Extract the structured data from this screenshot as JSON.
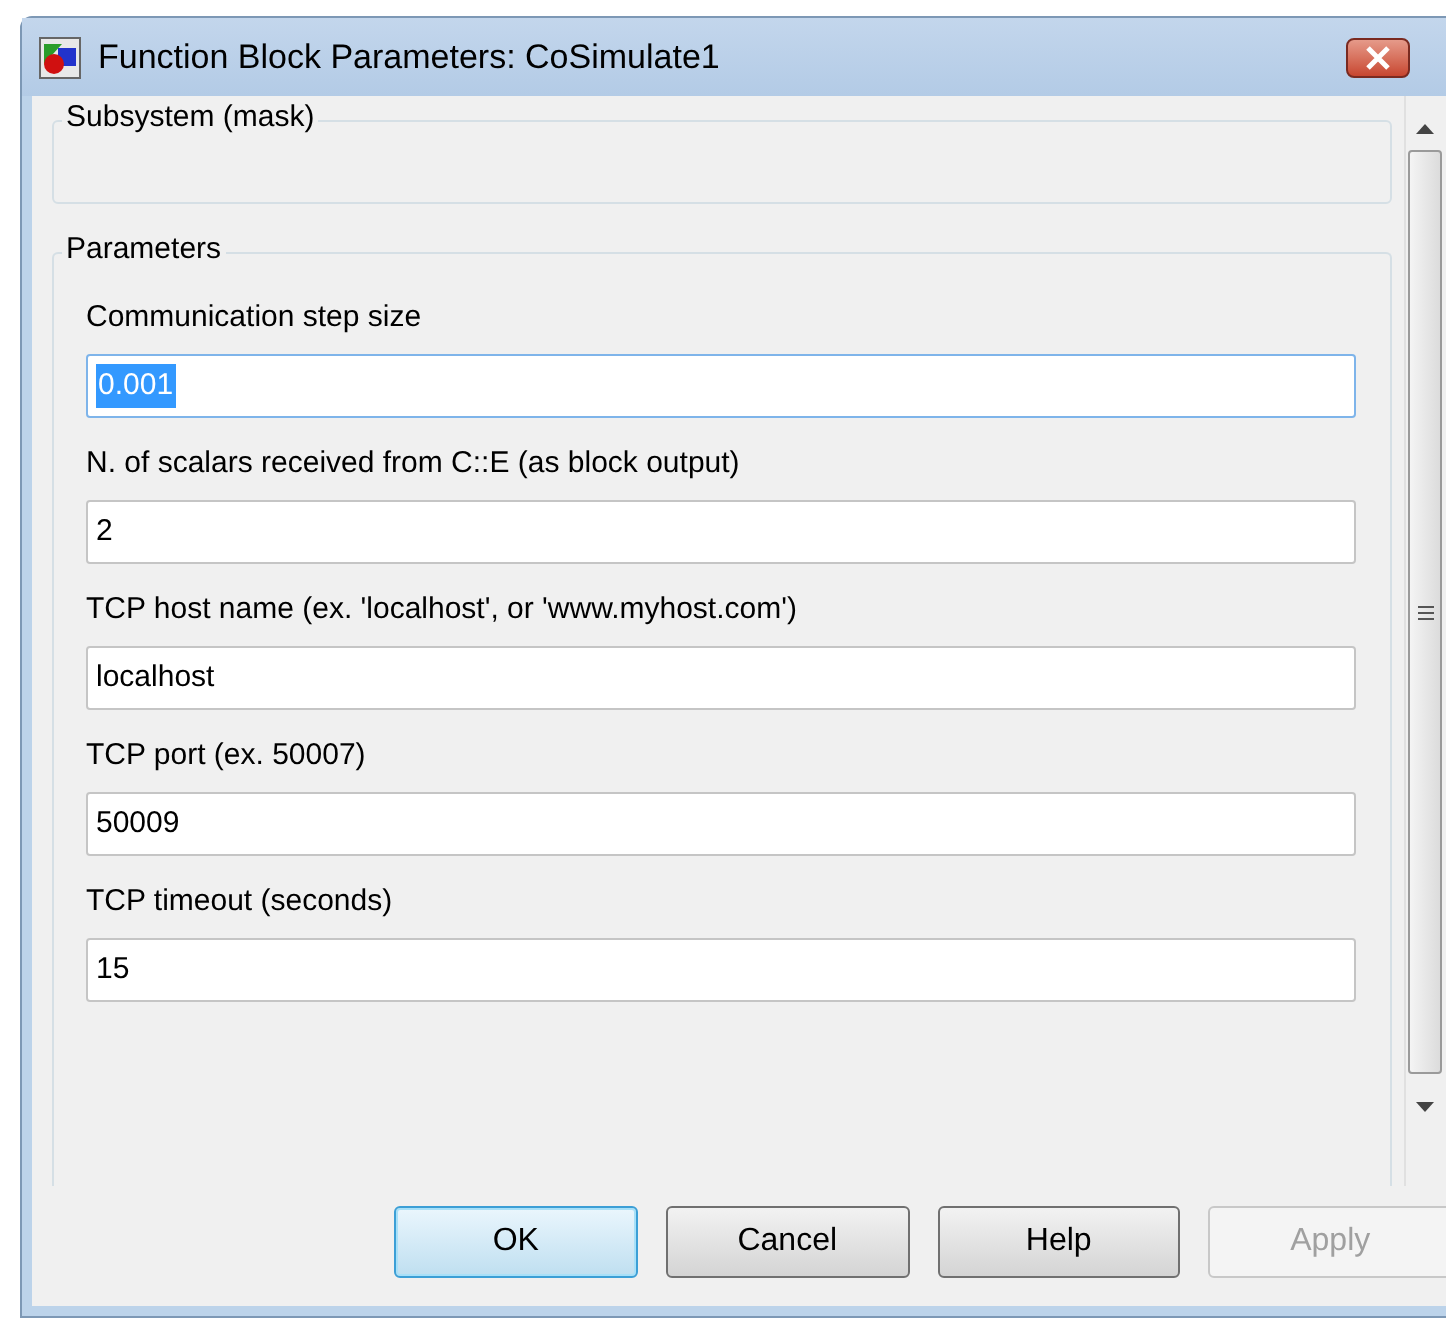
{
  "window": {
    "title": "Function Block Parameters: CoSimulate1"
  },
  "description_group": {
    "title": "Subsystem (mask)"
  },
  "parameters_group": {
    "title": "Parameters",
    "fields": [
      {
        "label": "Communication step size",
        "value": "0.001",
        "focused": true
      },
      {
        "label": "N. of scalars received from C::E (as block output)",
        "value": "2",
        "focused": false
      },
      {
        "label": "TCP host name (ex. 'localhost', or 'www.myhost.com')",
        "value": "localhost",
        "focused": false
      },
      {
        "label": "TCP port (ex. 50007)",
        "value": "50009",
        "focused": false
      },
      {
        "label": "TCP timeout (seconds)",
        "value": "15",
        "focused": false
      }
    ]
  },
  "buttons": [
    {
      "label": "OK",
      "default": true,
      "disabled": false
    },
    {
      "label": "Cancel",
      "default": false,
      "disabled": false
    },
    {
      "label": "Help",
      "default": false,
      "disabled": false
    },
    {
      "label": "Apply",
      "default": false,
      "disabled": true
    }
  ]
}
